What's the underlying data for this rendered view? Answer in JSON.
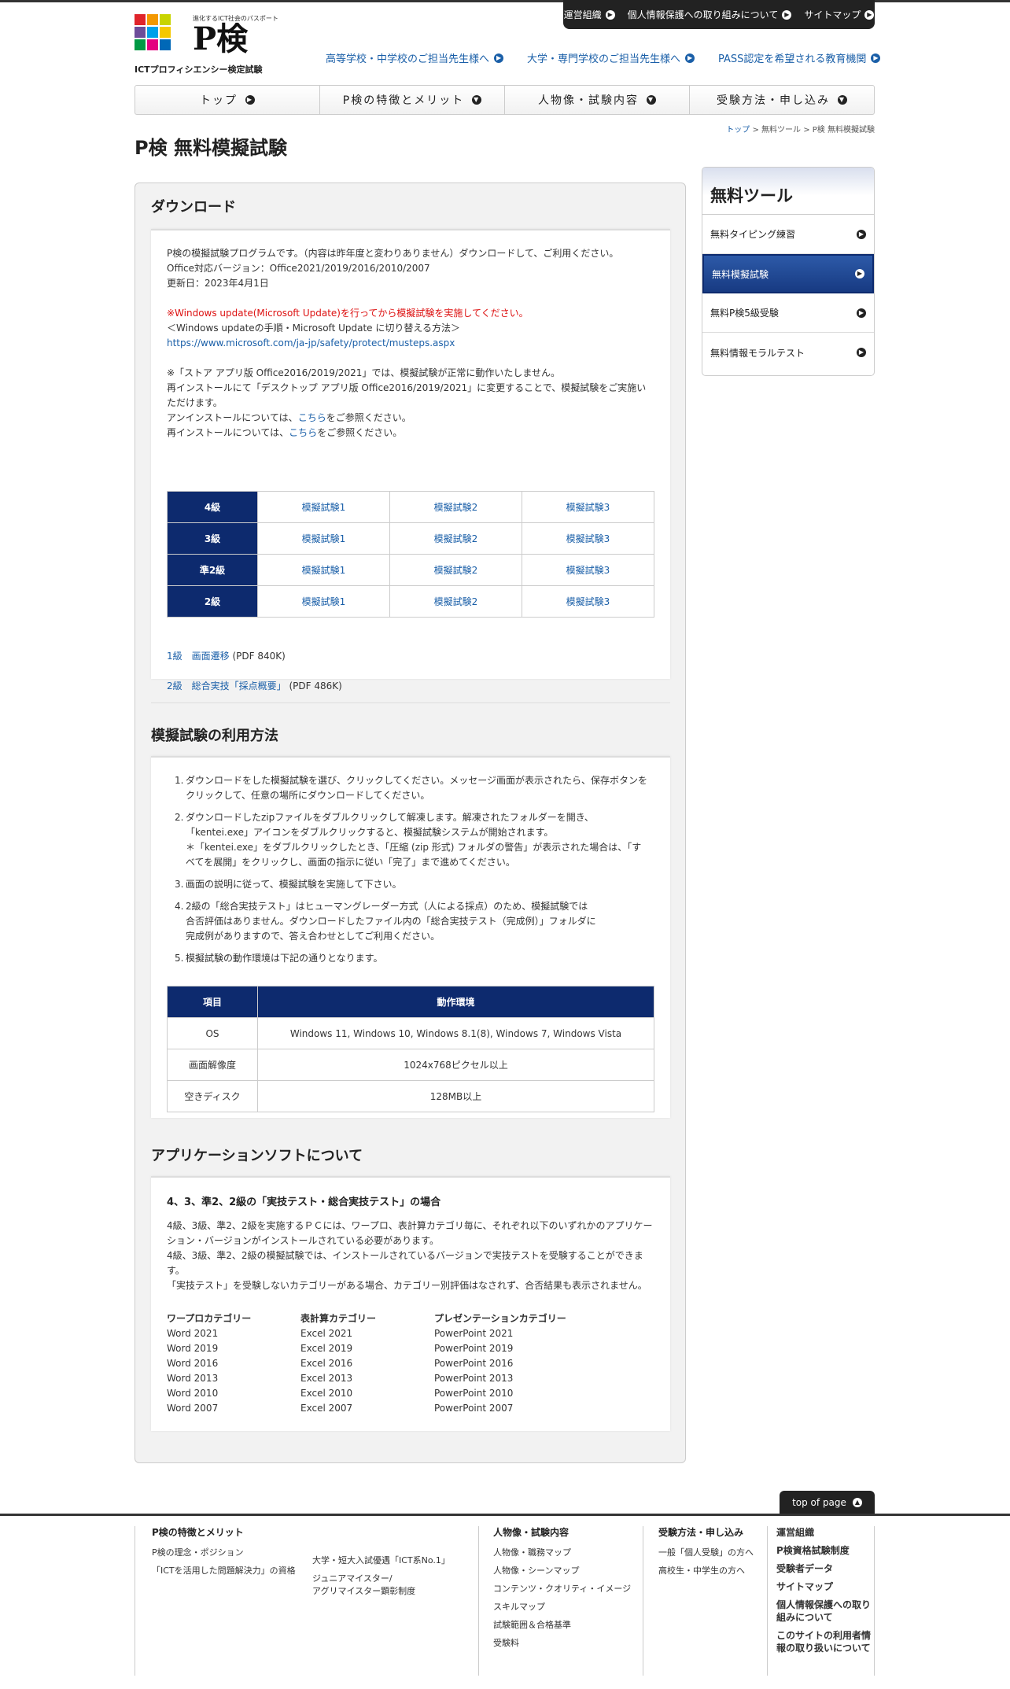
{
  "utility": {
    "items": [
      "運営組織",
      "個人情報保護への取り組みについて",
      "サイトマップ"
    ]
  },
  "logo": {
    "tagline": "進化するICT社会のパスポート",
    "mark": "P検",
    "subtitle": "ICTプロフィシエンシー検定試験"
  },
  "audience_nav": [
    "高等学校・中学校のご担当先生様へ",
    "大学・専門学校のご担当先生様へ",
    "PASS認定を希望される教育機関"
  ],
  "global_nav": [
    "トップ",
    "P検の特徴とメリット",
    "人物像・試験内容",
    "受験方法・申し込み"
  ],
  "breadcrumb": {
    "home": "トップ",
    "mid": "無料ツール",
    "current": "P検 無料模擬試験",
    "sep": ">"
  },
  "page_title": "P検 無料模擬試験",
  "download": {
    "heading": "ダウンロード",
    "intro": "P検の模擬試験プログラムです。（内容は昨年度と変わりありません）ダウンロードして、ご利用ください。",
    "versions": "Office対応バージョン：Office2021/2019/2016/2010/2007",
    "updated": "更新日：2023年4月1日",
    "warning": "※Windows update(Microsoft Update)を行ってから模擬試験を実施してください。",
    "howto": "＜Windows updateの手順・Microsoft Update に切り替える方法＞",
    "url": "https://www.microsoft.com/ja-jp/safety/protect/musteps.aspx",
    "store_note_1": "※「ストア アプリ版 Office2016/2019/2021」では、模擬試験が正常に動作いたしません。",
    "store_note_2": "再インストールにて「デスクトップ アプリ版 Office2016/2019/2021」に変更することで、模擬試験をご実施いただけます。",
    "uninstall_pre": "アンインストールについては、",
    "reinstall_pre": "再インストールについては、",
    "here": "こちら",
    "refer_post": "をご参照ください。",
    "grades": [
      {
        "grade": "4級",
        "links": [
          "模擬試験1",
          "模擬試験2",
          "模擬試験3"
        ]
      },
      {
        "grade": "3級",
        "links": [
          "模擬試験1",
          "模擬試験2",
          "模擬試験3"
        ]
      },
      {
        "grade": "準2級",
        "links": [
          "模擬試験1",
          "模擬試験2",
          "模擬試験3"
        ]
      },
      {
        "grade": "2級",
        "links": [
          "模擬試験1",
          "模擬試験2",
          "模擬試験3"
        ]
      }
    ],
    "pdf1_link": "1級　画面遷移",
    "pdf1_size": "(PDF 840K)",
    "pdf2_link": "2級　総合実技「採点概要」",
    "pdf2_size": "(PDF 486K)"
  },
  "usage": {
    "heading": "模擬試験の利用方法",
    "steps": [
      {
        "num": "1.",
        "lines": [
          "ダウンロードをした模擬試験を選び、クリックしてください。メッセージ画面が表示されたら、保存ボタンを",
          "クリックして、任意の場所にダウンロードしてください。"
        ]
      },
      {
        "num": "2.",
        "lines": [
          "ダウンロードしたzipファイルをダブルクリックして解凍します。解凍されたフォルダーを開き、",
          "「kentei.exe」アイコンをダブルクリックすると、模擬試験システムが開始されます。",
          "＊「kentei.exe」をダブルクリックしたとき、「圧縮 (zip 形式) フォルダの警告」が表示された場合は、「す",
          "べてを展開」をクリックし、画面の指示に従い「完了」まで進めてください。"
        ]
      },
      {
        "num": "3.",
        "lines": [
          "画面の説明に従って、模擬試験を実施して下さい。"
        ]
      },
      {
        "num": "4.",
        "lines": [
          "2級の「総合実技テスト」はヒューマングレーダー方式（人による採点）のため、模擬試験では",
          "合否評価はありません。ダウンロードしたファイル内の「総合実技テスト（完成例）」フォルダに",
          "完成例がありますので、答え合わせとしてご利用ください。"
        ]
      },
      {
        "num": "5.",
        "lines": [
          "模擬試験の動作環境は下記の通りとなります。"
        ]
      }
    ],
    "env_headers": [
      "項目",
      "動作環境"
    ],
    "env_rows": [
      {
        "item": "OS",
        "value": "Windows 11, Windows 10, Windows 8.1(8), Windows 7, Windows Vista"
      },
      {
        "item": "画面解像度",
        "value": "1024x768ピクセル以上"
      },
      {
        "item": "空きディスク",
        "value": "128MB以上"
      }
    ]
  },
  "apps": {
    "heading": "アプリケーションソフトについて",
    "subheading": "4、3、準2、2級の「実技テスト・総合実技テスト」の場合",
    "p1": "4級、3級、準2、2級を実施するＰＣには、ワープロ、表計算カテゴリ毎に、それぞれ以下のいずれかのアプリケーション・バージョンがインストールされている必要があります。",
    "p2": "4級、3級、準2、2級の模擬試験では、インストールされているバージョンで実技テストを受験することができます。",
    "p3": "「実技テスト」を受験しないカテゴリーがある場合、カテゴリー別評価はなされず、合否結果も表示されません。",
    "categories": [
      {
        "name": "ワープロカテゴリー",
        "items": [
          "Word 2021",
          "Word 2019",
          "Word 2016",
          "Word 2013",
          "Word 2010",
          "Word 2007"
        ]
      },
      {
        "name": "表計算カテゴリー",
        "items": [
          "Excel 2021",
          "Excel 2019",
          "Excel 2016",
          "Excel 2013",
          "Excel 2010",
          "Excel 2007"
        ]
      },
      {
        "name": "プレゼンテーションカテゴリー",
        "items": [
          "PowerPoint 2021",
          "PowerPoint 2019",
          "PowerPoint 2016",
          "PowerPoint 2013",
          "PowerPoint 2010",
          "PowerPoint 2007"
        ]
      }
    ]
  },
  "sidebar": {
    "title": "無料ツール",
    "items": [
      "無料タイピング練習",
      "無料模擬試験",
      "無料P検5級受験",
      "無料情報モラルテスト"
    ]
  },
  "top_of_page": "top of page",
  "footer": {
    "col1_title": "P検の特徴とメリット",
    "col1_a": [
      "P検の理念・ポジション",
      "「ICTを活用した問題解決力」の資格"
    ],
    "col1_b": [
      "大学・短大入試優遇「ICT系No.1」",
      "ジュニアマイスター/",
      "アグリマイスター顕彰制度"
    ],
    "col2_title": "人物像・試験内容",
    "col2": [
      "人物像・職務マップ",
      "人物像・シーンマップ",
      "コンテンツ・クオリティ・イメージ",
      "スキルマップ",
      "試験範囲＆合格基準",
      "受験料"
    ],
    "col3_title": "受験方法・申し込み",
    "col3": [
      "一般「個人受験」の方へ",
      "高校生・中学生の方へ"
    ],
    "col4": [
      "運営組織",
      "P検資格試験制度",
      "受験者データ",
      "サイトマップ",
      "個人情報保護への取り",
      "組みについて",
      "このサイトの利用者情",
      "報の取り扱いについて"
    ]
  }
}
